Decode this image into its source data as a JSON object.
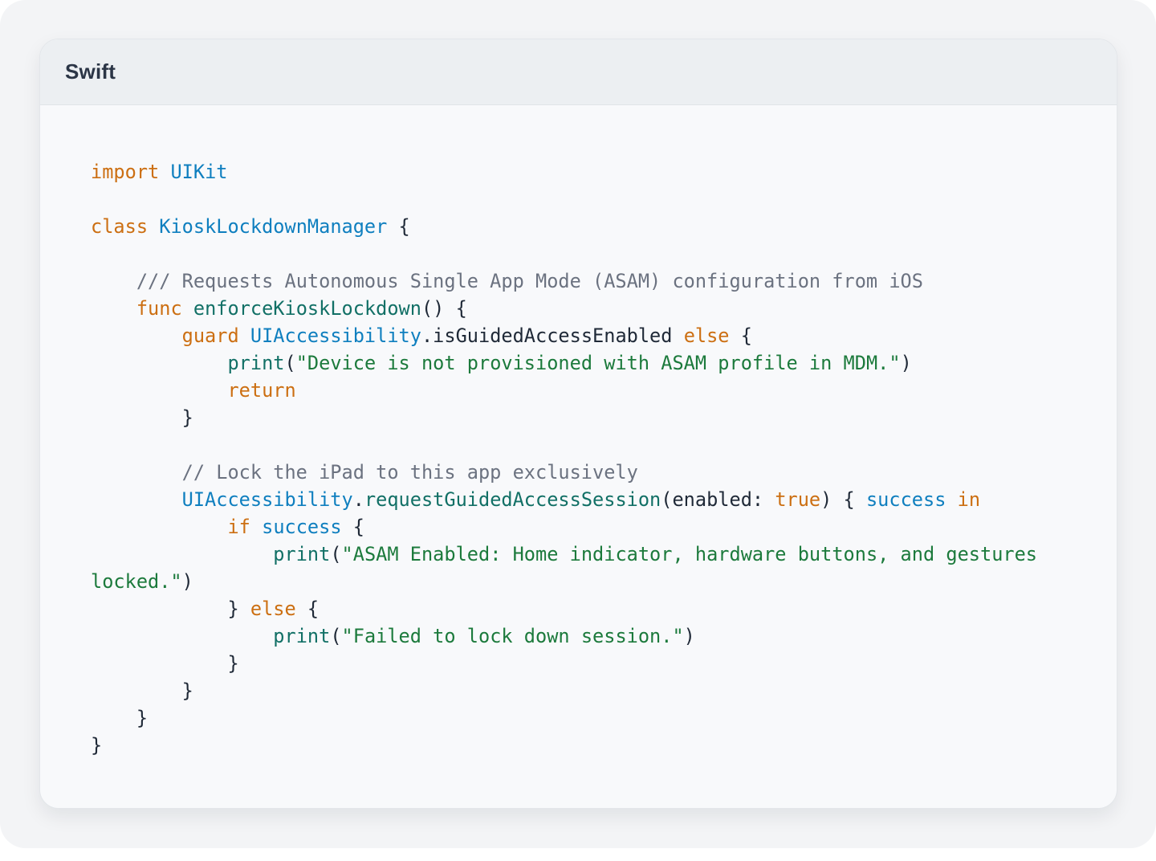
{
  "header": {
    "language": "Swift"
  },
  "code_lines": [
    [
      {
        "t": "kw",
        "v": "import"
      },
      {
        "t": "pl",
        "v": " "
      },
      {
        "t": "ty",
        "v": "UIKit"
      }
    ],
    [],
    [
      {
        "t": "kw",
        "v": "class"
      },
      {
        "t": "pl",
        "v": " "
      },
      {
        "t": "ty",
        "v": "KioskLockdownManager"
      },
      {
        "t": "pl",
        "v": " {"
      }
    ],
    [],
    [
      {
        "t": "pl",
        "v": "    "
      },
      {
        "t": "cm",
        "v": "/// Requests Autonomous Single App Mode (ASAM) configuration from iOS"
      }
    ],
    [
      {
        "t": "pl",
        "v": "    "
      },
      {
        "t": "kw",
        "v": "func"
      },
      {
        "t": "pl",
        "v": " "
      },
      {
        "t": "fn",
        "v": "enforceKioskLockdown"
      },
      {
        "t": "pl",
        "v": "() {"
      }
    ],
    [
      {
        "t": "pl",
        "v": "        "
      },
      {
        "t": "kw",
        "v": "guard"
      },
      {
        "t": "pl",
        "v": " "
      },
      {
        "t": "ty",
        "v": "UIAccessibility"
      },
      {
        "t": "pl",
        "v": ".isGuidedAccessEnabled "
      },
      {
        "t": "kw",
        "v": "else"
      },
      {
        "t": "pl",
        "v": " {"
      }
    ],
    [
      {
        "t": "pl",
        "v": "            "
      },
      {
        "t": "fn",
        "v": "print"
      },
      {
        "t": "pl",
        "v": "("
      },
      {
        "t": "str",
        "v": "\"Device is not provisioned with ASAM profile in MDM.\""
      },
      {
        "t": "pl",
        "v": ")"
      }
    ],
    [
      {
        "t": "pl",
        "v": "            "
      },
      {
        "t": "kw",
        "v": "return"
      }
    ],
    [
      {
        "t": "pl",
        "v": "        }"
      }
    ],
    [],
    [
      {
        "t": "pl",
        "v": "        "
      },
      {
        "t": "cm",
        "v": "// Lock the iPad to this app exclusively"
      }
    ],
    [
      {
        "t": "pl",
        "v": "        "
      },
      {
        "t": "ty",
        "v": "UIAccessibility"
      },
      {
        "t": "pl",
        "v": "."
      },
      {
        "t": "fn",
        "v": "requestGuidedAccessSession"
      },
      {
        "t": "pl",
        "v": "(enabled: "
      },
      {
        "t": "kw",
        "v": "true"
      },
      {
        "t": "pl",
        "v": ") { "
      },
      {
        "t": "ty",
        "v": "success"
      },
      {
        "t": "pl",
        "v": " "
      },
      {
        "t": "kw",
        "v": "in"
      }
    ],
    [
      {
        "t": "pl",
        "v": "            "
      },
      {
        "t": "kw",
        "v": "if"
      },
      {
        "t": "pl",
        "v": " "
      },
      {
        "t": "ty",
        "v": "success"
      },
      {
        "t": "pl",
        "v": " {"
      }
    ],
    [
      {
        "t": "pl",
        "v": "                "
      },
      {
        "t": "fn",
        "v": "print"
      },
      {
        "t": "pl",
        "v": "("
      },
      {
        "t": "str",
        "v": "\"ASAM Enabled: Home indicator, hardware buttons, and gestures"
      }
    ],
    [
      {
        "t": "str",
        "v": "locked.\""
      },
      {
        "t": "pl",
        "v": ")"
      }
    ],
    [
      {
        "t": "pl",
        "v": "            } "
      },
      {
        "t": "kw",
        "v": "else"
      },
      {
        "t": "pl",
        "v": " {"
      }
    ],
    [
      {
        "t": "pl",
        "v": "                "
      },
      {
        "t": "fn",
        "v": "print"
      },
      {
        "t": "pl",
        "v": "("
      },
      {
        "t": "str",
        "v": "\"Failed to lock down session.\""
      },
      {
        "t": "pl",
        "v": ")"
      }
    ],
    [
      {
        "t": "pl",
        "v": "            }"
      }
    ],
    [
      {
        "t": "pl",
        "v": "        }"
      }
    ],
    [
      {
        "t": "pl",
        "v": "    }"
      }
    ],
    [
      {
        "t": "pl",
        "v": "}"
      }
    ]
  ]
}
